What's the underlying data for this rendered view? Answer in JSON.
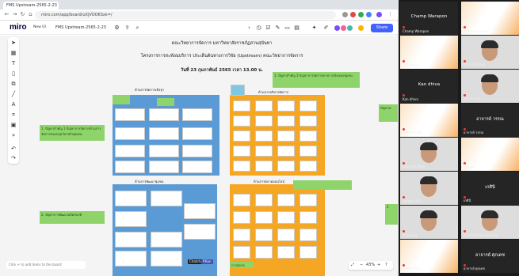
{
  "browser": {
    "tab_title": "FMS Upstream-2565-2-23 - Miro",
    "url": "miro.com/app/board/uXjVOO6Sxk=/",
    "colors": {
      "accent": "#4262ff",
      "tabstrip": "#dee1e6"
    }
  },
  "miro": {
    "logo": "miro",
    "new_label": "New UI",
    "board_name": "FMS Upstream-2565-2-23",
    "share_label": "Share",
    "zoom": "43%",
    "bottom_hint": "Click + to add items to the board"
  },
  "board": {
    "title1": "คณะวิทยาการจัดการ มหาวิทยาลัยราชภัฏสวนสุนันทา",
    "title2": "โครงการการสะท้อนบริการ ประเด็นต้นทางการวิจัย (Upstream) คณะวิทยาการจัดการ",
    "title3": "วันที่ 23 กุมภาพันธ์ 2565 เวลา 13.00 น.",
    "issue1": "1. ปัญหาสำคัญ 1 ปัญหาการจัดการด้านการจัดการของกลุ่มวิสาหกิจชุมชน",
    "issue2": "2. ปัญหาการพัฒนาผลิตภัณฑ์",
    "issue3": "1. ปัญหาสำคัญ 3 ปัญหาการจัดการทางการเงินของชุมชน",
    "frame_a_header": "ด้านการจัดการเชิงรุก",
    "frame_b_header": "ด้านการพัฒนาชุมชน",
    "frame_c_header": "ด้านการบริหารจัดการ",
    "frame_d_header": "ด้านการตลาดออนไลน์",
    "frame_e_header": "การตลาด",
    "side_green": "ปัญหาด",
    "side_green2": "2",
    "cursor1": "Chatchai",
    "cursor2": "P.Kun"
  },
  "participants": [
    {
      "name": "Champ Warapon",
      "video": false
    },
    {
      "name": "champ warapon",
      "video": false
    },
    {
      "name": "Kan dhiva",
      "video": false
    },
    {
      "name": "อาจารย์ สุภาพร",
      "video": true
    },
    {
      "name": "Kan dhiva",
      "video": false
    },
    {
      "name": "ผศ.ดร.นวพร",
      "video": true
    },
    {
      "name": "ลำพันระดับชั้น",
      "video": false
    },
    {
      "name": "อาจารย์ วรรณ",
      "video": false
    },
    {
      "name": "เบญจรัตน์ ศรีสุข",
      "video": true
    },
    {
      "name": "sangrit",
      "video": false
    },
    {
      "name": "Tanakrit Kit",
      "video": true
    },
    {
      "name": "เกศินี",
      "video": false
    },
    {
      "name": "Piyapong",
      "video": true
    },
    {
      "name": "Asst.Prof.Dr.Laddawan",
      "video": true
    },
    {
      "name": "ลำพักษาพงษ์...",
      "video": false
    },
    {
      "name": "อาจารย์ ศุภเดช",
      "video": false
    },
    {
      "name": "ศศิธร",
      "video": false
    },
    {
      "name": "ปาริชาติ",
      "video": true
    }
  ]
}
